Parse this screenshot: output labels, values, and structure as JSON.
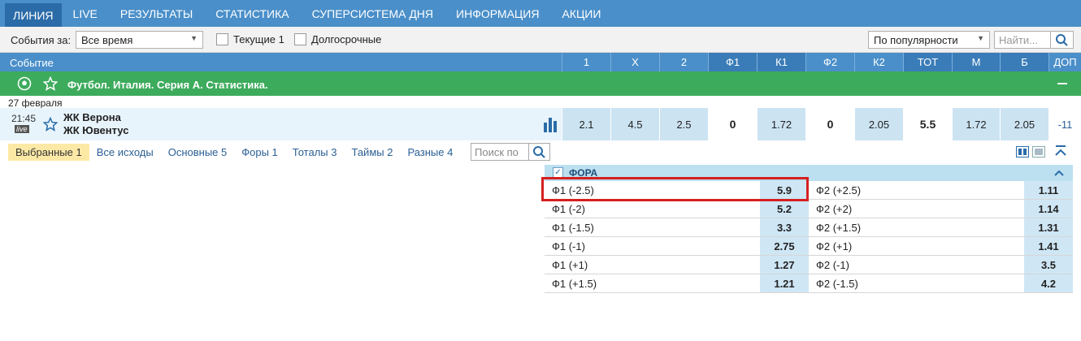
{
  "nav": [
    "ЛИНИЯ",
    "LIVE",
    "РЕЗУЛЬТАТЫ",
    "СТАТИСТИКА",
    "СУПЕРСИСТЕМА ДНЯ",
    "ИНФОРМАЦИЯ",
    "АКЦИИ"
  ],
  "filter": {
    "events_label": "События за:",
    "period_value": "Все время",
    "current_label": "Текущие 1",
    "longterm_label": "Долгосрочные",
    "sort_value": "По популярности",
    "search_placeholder": "Найти..."
  },
  "header": {
    "event_label": "Событие",
    "cols": [
      "1",
      "X",
      "2",
      "Ф1",
      "К1",
      "Ф2",
      "К2",
      "ТОТ",
      "М",
      "Б",
      "ДОП"
    ]
  },
  "league": {
    "title": "Футбол. Италия. Серия А. Статистика."
  },
  "date": "27 февраля",
  "match": {
    "time": "21:45",
    "live": "live",
    "team1": "ЖК Верона",
    "team2": "ЖК Ювентус",
    "odds": [
      "2.1",
      "4.5",
      "2.5",
      "0",
      "1.72",
      "0",
      "2.05",
      "5.5",
      "1.72",
      "2.05",
      "-11"
    ]
  },
  "tabs": [
    "Выбранные 1",
    "Все исходы",
    "Основные 5",
    "Форы 1",
    "Тоталы 3",
    "Таймы 2",
    "Разные 4"
  ],
  "tab_search_placeholder": "Поиск по",
  "fora": {
    "title": "ФОРА",
    "rows": [
      {
        "l": "Ф1 (-2.5)",
        "lv": "5.9",
        "r": "Ф2 (+2.5)",
        "rv": "1.11"
      },
      {
        "l": "Ф1 (-2)",
        "lv": "5.2",
        "r": "Ф2 (+2)",
        "rv": "1.14"
      },
      {
        "l": "Ф1 (-1.5)",
        "lv": "3.3",
        "r": "Ф2 (+1.5)",
        "rv": "1.31"
      },
      {
        "l": "Ф1 (-1)",
        "lv": "2.75",
        "r": "Ф2 (+1)",
        "rv": "1.41"
      },
      {
        "l": "Ф1 (+1)",
        "lv": "1.27",
        "r": "Ф2 (-1)",
        "rv": "3.5"
      },
      {
        "l": "Ф1 (+1.5)",
        "lv": "1.21",
        "r": "Ф2 (-1.5)",
        "rv": "4.2"
      }
    ]
  }
}
